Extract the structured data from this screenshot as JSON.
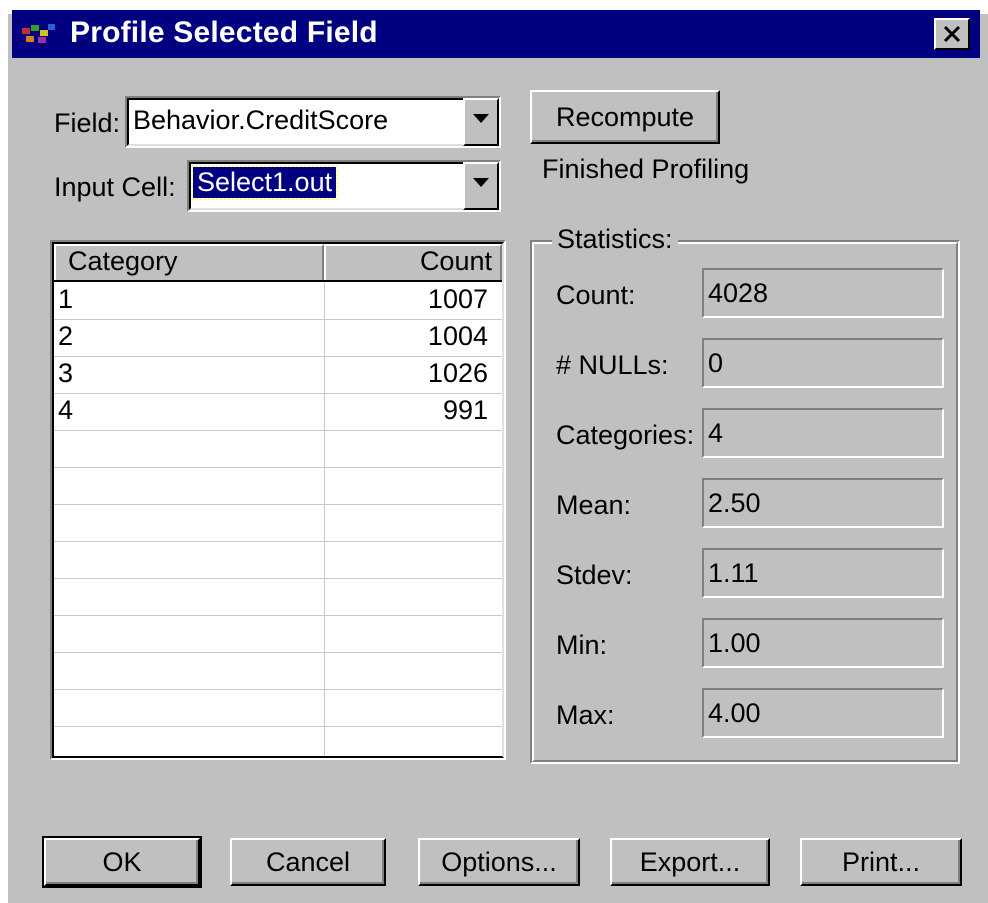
{
  "window": {
    "title": "Profile Selected Field",
    "app_icon": "multicolor-app-icon",
    "close_icon": "close-x-icon"
  },
  "field": {
    "label": "Field:",
    "value": "Behavior.CreditScore"
  },
  "input_cell": {
    "label": "Input Cell:",
    "value": "Select1.out"
  },
  "recompute_label": "Recompute",
  "status_text": "Finished Profiling",
  "table": {
    "headers": [
      "Category",
      "Count"
    ],
    "rows": [
      [
        "1",
        "1007"
      ],
      [
        "2",
        "1004"
      ],
      [
        "3",
        "1026"
      ],
      [
        "4",
        "991"
      ]
    ]
  },
  "statistics": {
    "title": "Statistics:",
    "items": [
      {
        "label": "Count:",
        "value": "4028"
      },
      {
        "label": "# NULLs:",
        "value": "0"
      },
      {
        "label": "Categories:",
        "value": "4"
      },
      {
        "label": "Mean:",
        "value": "2.50"
      },
      {
        "label": "Stdev:",
        "value": "1.11"
      },
      {
        "label": "Min:",
        "value": "1.00"
      },
      {
        "label": "Max:",
        "value": "4.00"
      }
    ]
  },
  "buttons": {
    "ok": "OK",
    "cancel": "Cancel",
    "options": "Options...",
    "export": "Export...",
    "print": "Print..."
  },
  "colors": {
    "titlebar": "#000080",
    "dialog_bg": "#c0c0c0",
    "selection": "#000080"
  }
}
